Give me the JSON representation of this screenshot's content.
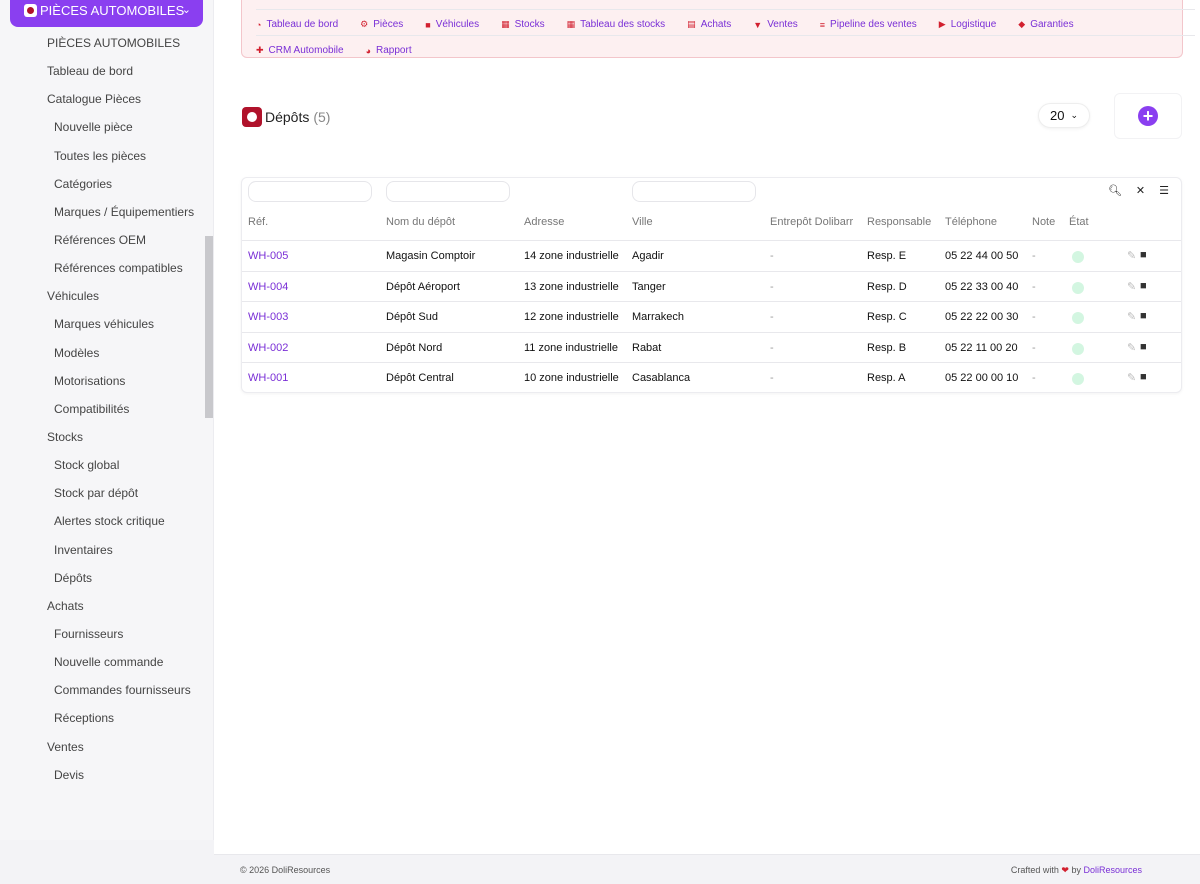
{
  "sidebar": {
    "module_label": "PIÈCES AUTOMOBILES",
    "items": [
      {
        "label": "PIÈCES AUTOMOBILES",
        "level": 1
      },
      {
        "label": "Tableau de bord",
        "level": 1
      },
      {
        "label": "Catalogue Pièces",
        "level": 1
      },
      {
        "label": "Nouvelle pièce",
        "level": 2
      },
      {
        "label": "Toutes les pièces",
        "level": 2
      },
      {
        "label": "Catégories",
        "level": 2
      },
      {
        "label": "Marques / Équipementiers",
        "level": 2
      },
      {
        "label": "Références OEM",
        "level": 2
      },
      {
        "label": "Références compatibles",
        "level": 2
      },
      {
        "label": "Véhicules",
        "level": 1
      },
      {
        "label": "Marques véhicules",
        "level": 2
      },
      {
        "label": "Modèles",
        "level": 2
      },
      {
        "label": "Motorisations",
        "level": 2
      },
      {
        "label": "Compatibilités",
        "level": 2
      },
      {
        "label": "Stocks",
        "level": 1
      },
      {
        "label": "Stock global",
        "level": 2
      },
      {
        "label": "Stock par dépôt",
        "level": 2
      },
      {
        "label": "Alertes stock critique",
        "level": 2
      },
      {
        "label": "Inventaires",
        "level": 2
      },
      {
        "label": "Dépôts",
        "level": 2
      },
      {
        "label": "Achats",
        "level": 1
      },
      {
        "label": "Fournisseurs",
        "level": 2
      },
      {
        "label": "Nouvelle commande",
        "level": 2
      },
      {
        "label": "Commandes fournisseurs",
        "level": 2
      },
      {
        "label": "Réceptions",
        "level": 2
      },
      {
        "label": "Ventes",
        "level": 1
      },
      {
        "label": "Devis",
        "level": 2
      }
    ]
  },
  "topmenu": {
    "row1": [
      {
        "label": "Tableau de bord",
        "icon": "gauge-icon"
      },
      {
        "label": "Pièces",
        "icon": "gear-icon"
      },
      {
        "label": "Véhicules",
        "icon": "car-icon"
      },
      {
        "label": "Stocks",
        "icon": "boxes-icon"
      },
      {
        "label": "Tableau des stocks",
        "icon": "grid-icon"
      },
      {
        "label": "Achats",
        "icon": "invoice-icon"
      },
      {
        "label": "Ventes",
        "icon": "cart-icon"
      },
      {
        "label": "Pipeline des ventes",
        "icon": "bars-icon"
      },
      {
        "label": "Logistique",
        "icon": "truck-icon"
      },
      {
        "label": "Garanties",
        "icon": "shield-icon"
      }
    ],
    "row2": [
      {
        "label": "CRM Automobile",
        "icon": "user-plus-icon"
      },
      {
        "label": "Rapport",
        "icon": "pie-chart-icon"
      }
    ]
  },
  "page": {
    "title": "Dépôts",
    "count": "(5)",
    "page_size": "20"
  },
  "table": {
    "columns": [
      "Réf.",
      "Nom du dépôt",
      "Adresse",
      "Ville",
      "Entrepôt Dolibarr",
      "Responsable",
      "Téléphone",
      "Note",
      "État"
    ],
    "rows": [
      {
        "ref": "WH-005",
        "name": "Magasin Comptoir",
        "address": "14 zone industrielle",
        "city": "Agadir",
        "warehouse": "-",
        "manager": "Resp. E",
        "phone": "05 22 44 00 50",
        "note": "-"
      },
      {
        "ref": "WH-004",
        "name": "Dépôt Aéroport",
        "address": "13 zone industrielle",
        "city": "Tanger",
        "warehouse": "-",
        "manager": "Resp. D",
        "phone": "05 22 33 00 40",
        "note": "-"
      },
      {
        "ref": "WH-003",
        "name": "Dépôt Sud",
        "address": "12 zone industrielle",
        "city": "Marrakech",
        "warehouse": "-",
        "manager": "Resp. C",
        "phone": "05 22 22 00 30",
        "note": "-"
      },
      {
        "ref": "WH-002",
        "name": "Dépôt Nord",
        "address": "11 zone industrielle",
        "city": "Rabat",
        "warehouse": "-",
        "manager": "Resp. B",
        "phone": "05 22 11 00 20",
        "note": "-"
      },
      {
        "ref": "WH-001",
        "name": "Dépôt Central",
        "address": "10 zone industrielle",
        "city": "Casablanca",
        "warehouse": "-",
        "manager": "Resp. A",
        "phone": "05 22 00 00 10",
        "note": "-"
      }
    ]
  },
  "footer": {
    "copyright": "© 2026 DoliResources",
    "crafted": "Crafted with",
    "by": "by",
    "brand": "DoliResources"
  },
  "colors": {
    "accent": "#8a3ff0",
    "brand_red": "#b0122b",
    "menu_icon": "#d2202f",
    "link": "#7a2fd6"
  }
}
